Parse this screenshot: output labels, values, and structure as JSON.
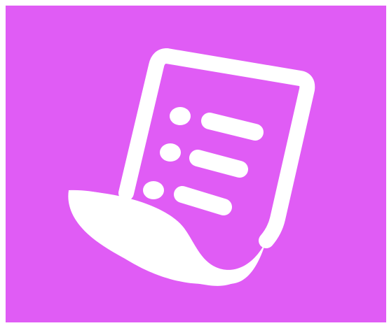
{
  "app_icon": {
    "icon_name": "receipt-list-icon",
    "background_color": "#e05cf5",
    "foreground_color": "#ffffff"
  }
}
